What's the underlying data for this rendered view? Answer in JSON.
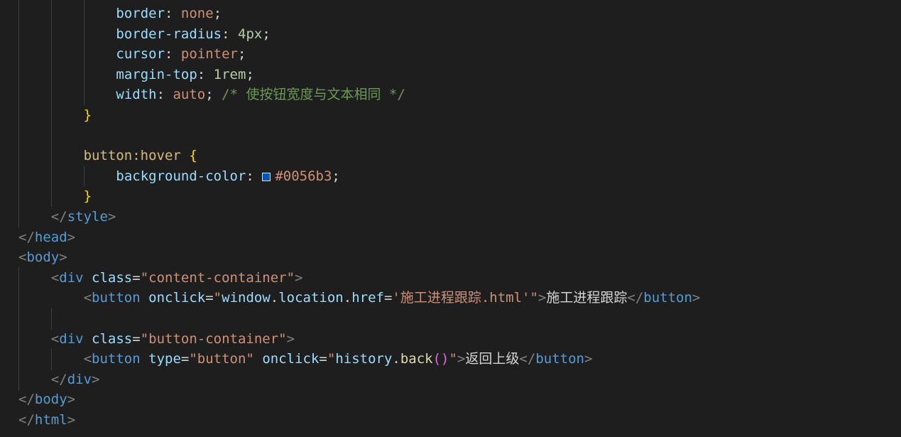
{
  "editor": {
    "lines": [
      {
        "indent": 6,
        "tokens": [
          {
            "t": "prop",
            "v": "border"
          },
          {
            "t": "plain",
            "v": ": "
          },
          {
            "t": "val",
            "v": "none"
          },
          {
            "t": "plain",
            "v": ";"
          }
        ]
      },
      {
        "indent": 6,
        "tokens": [
          {
            "t": "prop",
            "v": "border-radius"
          },
          {
            "t": "plain",
            "v": ": "
          },
          {
            "t": "num",
            "v": "4px"
          },
          {
            "t": "plain",
            "v": ";"
          }
        ]
      },
      {
        "indent": 6,
        "tokens": [
          {
            "t": "prop",
            "v": "cursor"
          },
          {
            "t": "plain",
            "v": ": "
          },
          {
            "t": "val",
            "v": "pointer"
          },
          {
            "t": "plain",
            "v": ";"
          }
        ]
      },
      {
        "indent": 6,
        "tokens": [
          {
            "t": "prop",
            "v": "margin-top"
          },
          {
            "t": "plain",
            "v": ": "
          },
          {
            "t": "num",
            "v": "1rem"
          },
          {
            "t": "plain",
            "v": ";"
          }
        ]
      },
      {
        "indent": 6,
        "tokens": [
          {
            "t": "prop",
            "v": "width"
          },
          {
            "t": "plain",
            "v": ": "
          },
          {
            "t": "val",
            "v": "auto"
          },
          {
            "t": "plain",
            "v": "; "
          },
          {
            "t": "comment",
            "v": "/* 使按钮宽度与文本相同 */"
          }
        ]
      },
      {
        "indent": 4,
        "tokens": [
          {
            "t": "brace",
            "v": "}"
          }
        ]
      },
      {
        "indent": 0,
        "tokens": []
      },
      {
        "indent": 4,
        "tokens": [
          {
            "t": "sel",
            "v": "button:hover"
          },
          {
            "t": "plain",
            "v": " "
          },
          {
            "t": "brace",
            "v": "{"
          }
        ]
      },
      {
        "indent": 6,
        "tokens": [
          {
            "t": "prop",
            "v": "background-color"
          },
          {
            "t": "plain",
            "v": ": "
          },
          {
            "t": "swatch",
            "v": "#0056b3"
          },
          {
            "t": "val",
            "v": "#0056b3"
          },
          {
            "t": "plain",
            "v": ";"
          }
        ]
      },
      {
        "indent": 4,
        "tokens": [
          {
            "t": "brace",
            "v": "}"
          }
        ]
      },
      {
        "indent": 2,
        "tokens": [
          {
            "t": "punct",
            "v": "</"
          },
          {
            "t": "tag",
            "v": "style"
          },
          {
            "t": "punct",
            "v": ">"
          }
        ]
      },
      {
        "indent": 0,
        "tokens": [
          {
            "t": "punct",
            "v": "</"
          },
          {
            "t": "tag",
            "v": "head"
          },
          {
            "t": "punct",
            "v": ">"
          }
        ]
      },
      {
        "indent": 0,
        "tokens": [
          {
            "t": "punct",
            "v": "<"
          },
          {
            "t": "tag",
            "v": "body"
          },
          {
            "t": "punct",
            "v": ">"
          }
        ]
      },
      {
        "indent": 2,
        "tokens": [
          {
            "t": "punct",
            "v": "<"
          },
          {
            "t": "tag",
            "v": "div"
          },
          {
            "t": "plain",
            "v": " "
          },
          {
            "t": "attr",
            "v": "class"
          },
          {
            "t": "plain",
            "v": "="
          },
          {
            "t": "str",
            "v": "\"content-container\""
          },
          {
            "t": "punct",
            "v": ">"
          }
        ]
      },
      {
        "indent": 4,
        "tokens": [
          {
            "t": "punct",
            "v": "<"
          },
          {
            "t": "tag",
            "v": "button"
          },
          {
            "t": "plain",
            "v": " "
          },
          {
            "t": "attr",
            "v": "onclick"
          },
          {
            "t": "plain",
            "v": "="
          },
          {
            "t": "str",
            "v": "\""
          },
          {
            "t": "attr",
            "v": "window"
          },
          {
            "t": "plain",
            "v": "."
          },
          {
            "t": "attr",
            "v": "location"
          },
          {
            "t": "plain",
            "v": "."
          },
          {
            "t": "attr",
            "v": "href"
          },
          {
            "t": "plain",
            "v": "="
          },
          {
            "t": "str",
            "v": "'施工进程跟踪.html'\""
          },
          {
            "t": "punct",
            "v": ">"
          },
          {
            "t": "text",
            "v": "施工进程跟踪"
          },
          {
            "t": "punct",
            "v": "</"
          },
          {
            "t": "tag",
            "v": "button"
          },
          {
            "t": "punct",
            "v": ">"
          }
        ]
      },
      {
        "indent": 0,
        "tokens": []
      },
      {
        "indent": 2,
        "tokens": [
          {
            "t": "punct",
            "v": "<"
          },
          {
            "t": "tag",
            "v": "div"
          },
          {
            "t": "plain",
            "v": " "
          },
          {
            "t": "attr",
            "v": "class"
          },
          {
            "t": "plain",
            "v": "="
          },
          {
            "t": "str",
            "v": "\"button-container\""
          },
          {
            "t": "punct",
            "v": ">"
          }
        ]
      },
      {
        "indent": 4,
        "tokens": [
          {
            "t": "punct",
            "v": "<"
          },
          {
            "t": "tag",
            "v": "button"
          },
          {
            "t": "plain",
            "v": " "
          },
          {
            "t": "attr",
            "v": "type"
          },
          {
            "t": "plain",
            "v": "="
          },
          {
            "t": "str",
            "v": "\"button\""
          },
          {
            "t": "plain",
            "v": " "
          },
          {
            "t": "attr",
            "v": "onclick"
          },
          {
            "t": "plain",
            "v": "="
          },
          {
            "t": "str",
            "v": "\""
          },
          {
            "t": "attr",
            "v": "history"
          },
          {
            "t": "plain",
            "v": "."
          },
          {
            "t": "fn",
            "v": "back"
          },
          {
            "t": "paren",
            "v": "()"
          },
          {
            "t": "str",
            "v": "\""
          },
          {
            "t": "punct",
            "v": ">"
          },
          {
            "t": "text",
            "v": "返回上级"
          },
          {
            "t": "punct",
            "v": "</"
          },
          {
            "t": "tag",
            "v": "button"
          },
          {
            "t": "punct",
            "v": ">"
          }
        ]
      },
      {
        "indent": 2,
        "tokens": [
          {
            "t": "punct",
            "v": "</"
          },
          {
            "t": "tag",
            "v": "div"
          },
          {
            "t": "punct",
            "v": ">"
          }
        ]
      },
      {
        "indent": 0,
        "tokens": [
          {
            "t": "punct",
            "v": "</"
          },
          {
            "t": "tag",
            "v": "body"
          },
          {
            "t": "punct",
            "v": ">"
          }
        ]
      },
      {
        "indent": 0,
        "tokens": [
          {
            "t": "punct",
            "v": "</"
          },
          {
            "t": "tag",
            "v": "html"
          },
          {
            "t": "punct",
            "v": ">"
          }
        ]
      }
    ]
  }
}
